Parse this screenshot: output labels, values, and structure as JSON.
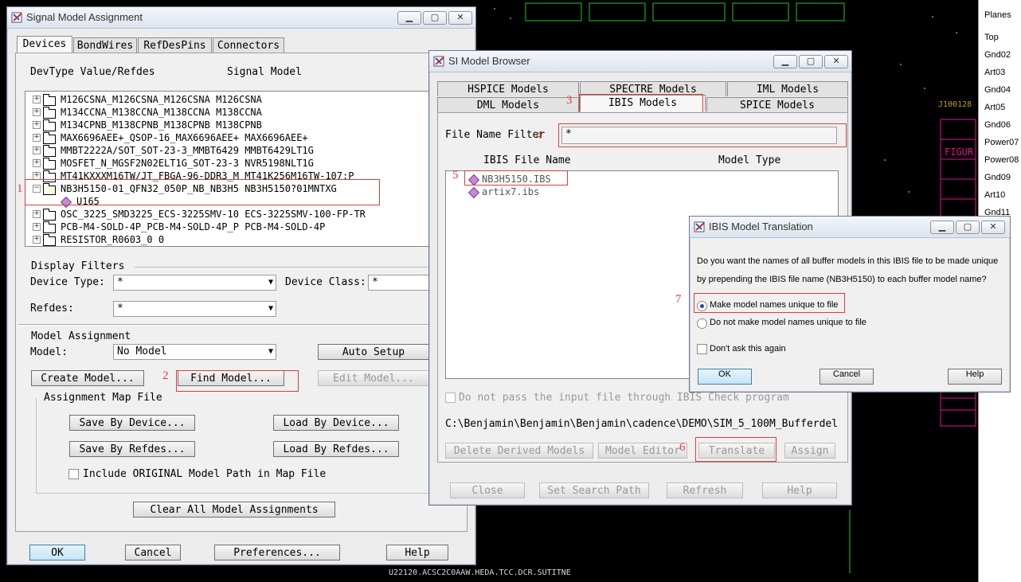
{
  "bg": {
    "top_text": "",
    "right_labels": [
      "Planes",
      "Top",
      "Gnd02",
      "Art03",
      "Gnd04",
      "Art05",
      "Gnd06",
      "Power07",
      "Power08",
      "Gnd09",
      "Art10",
      "Gnd11"
    ],
    "figure_text": "FIGUR",
    "ref_text": "J100128",
    "bottom_left_text": "U22120.ACSC2C0AAW.HEDA.TCC.DCR.SUTITNE"
  },
  "sma": {
    "title": "Signal Model Assignment",
    "tabs": [
      "Devices",
      "BondWires",
      "RefDesPins",
      "Connectors"
    ],
    "col_devtype": "DevType Value/Refdes",
    "col_signal": "Signal Model",
    "tree": [
      "M126CSNA_M126CSNA_M126CSNA M126CSNA",
      "M134CCNA_M138CCNA_M138CCNA M138CCNA",
      "M134CPNB_M138CPNB_M138CPNB M138CPNB",
      "MAX6696AEE+_QSOP-16_MAX6696AEE+ MAX6696AEE+",
      "MMBT2222A/SOT_SOT-23-3_MMBT6429 MMBT6429LT1G",
      "MOSFET_N_MGSF2N02ELT1G_SOT-23-3 NVR5198NLT1G",
      "MT41KXXXM16TW/JT_FBGA-96-DDR3_M MT41K256M16TW-107:P",
      "NB3H5150-01_QFN32_050P_NB_NB3H5 NB3H5150?01MNTXG",
      "U165",
      "OSC_3225_SMD3225_ECS-3225SMV-10 ECS-3225SMV-100-FP-TR",
      "PCB-M4-SOLD-4P_PCB-M4-SOLD-4P_P PCB-M4-SOLD-4P",
      "RESISTOR_R0603_0 0"
    ],
    "display_filters": "Display Filters",
    "device_type_label": "Device Type:",
    "device_type_value": "*",
    "device_class_label": "Device Class:",
    "device_class_value": "*",
    "refdes_label": "Refdes:",
    "refdes_value": "*",
    "model_assignment": "Model Assignment",
    "model_label": "Model:",
    "model_value": "No Model",
    "auto_setup": "Auto Setup",
    "create_model": "Create Model...",
    "find_model": "Find Model...",
    "edit_model": "Edit Model...",
    "assignment_map_file": "Assignment Map File",
    "save_by_device": "Save By Device...",
    "load_by_device": "Load By Device...",
    "save_by_refdes": "Save By Refdes...",
    "load_by_refdes": "Load By Refdes...",
    "include_original": "Include ORIGINAL Model Path in Map File",
    "clear_all": "Clear All Model Assignments",
    "ok": "OK",
    "cancel": "Cancel",
    "preferences": "Preferences...",
    "help": "Help"
  },
  "simb": {
    "title": "SI Model Browser",
    "tabs_row1": [
      "HSPICE Models",
      "SPECTRE Models",
      "IML Models"
    ],
    "tabs_row2": [
      "DML Models",
      "IBIS Models",
      "SPICE Models"
    ],
    "file_name_filter_label": "File Name Filter",
    "file_name_filter_value": "*",
    "col_ibis_file": "IBIS File Name",
    "col_model_type": "Model Type",
    "files": [
      "NB3H5150.IBS",
      "artix7.ibs"
    ],
    "do_not_pass": "Do not pass the input file through IBIS Check program",
    "path": "C:\\Benjamin\\Benjamin\\Benjamin\\cadence\\DEMO\\SIM_5_100M_Bufferdel",
    "delete_derived": "Delete Derived Models",
    "model_editor": "Model Editor",
    "translate": "Translate",
    "assign": "Assign",
    "close": "Close",
    "set_search_path": "Set Search Path",
    "refresh": "Refresh",
    "help": "Help"
  },
  "ibis": {
    "title": "IBIS Model Translation",
    "question_line1": "Do you want the names of all buffer models in this IBIS file to be made unique",
    "question_line2": "by prepending the IBIS file name (NB3H5150) to each buffer model name?",
    "opt_unique": "Make model names unique to file",
    "opt_not_unique": "Do not make model names unique to file",
    "dont_ask": "Don't ask this again",
    "ok": "OK",
    "cancel": "Cancel",
    "help": "Help"
  },
  "annotations": [
    "1",
    "2",
    "3",
    "4",
    "5",
    "6",
    "7"
  ],
  "colors": {
    "annotation_red": "#e23b3b",
    "pcb_green": "#25c425",
    "pcb_pink": "#e0138f"
  }
}
